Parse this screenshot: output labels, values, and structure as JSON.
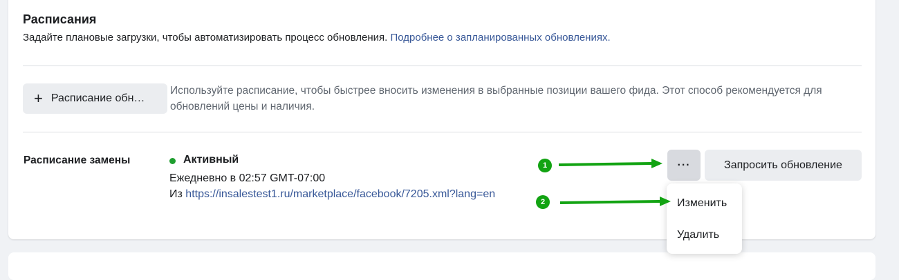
{
  "section": {
    "title": "Расписания",
    "subtitle_text": "Задайте плановые загрузки, чтобы автоматизировать процесс обновления.",
    "subtitle_link": "Подробнее о запланированных обновлениях."
  },
  "add_schedule": {
    "button_label": "Расписание обн…",
    "hint": "Используйте расписание, чтобы быстрее вносить изменения в выбранные позиции вашего фида. Этот способ рекомендуется для обновлений цены и наличия."
  },
  "replacement_schedule": {
    "label": "Расписание замены",
    "status": "Активный",
    "status_color": "#1e9e2f",
    "frequency": "Ежедневно в 02:57 GMT-07:00",
    "from_prefix": "Из",
    "source_url": "https://insalestest1.ru/marketplace/facebook/7205.xml?lang=en"
  },
  "actions": {
    "more_icon": "more-dots-icon",
    "more_label": "···",
    "request_update_label": "Запросить обновление"
  },
  "menu": {
    "items": [
      "Изменить",
      "Удалить"
    ]
  },
  "annotations": {
    "badge_1": "1",
    "badge_2": "2",
    "color": "#12a312"
  }
}
